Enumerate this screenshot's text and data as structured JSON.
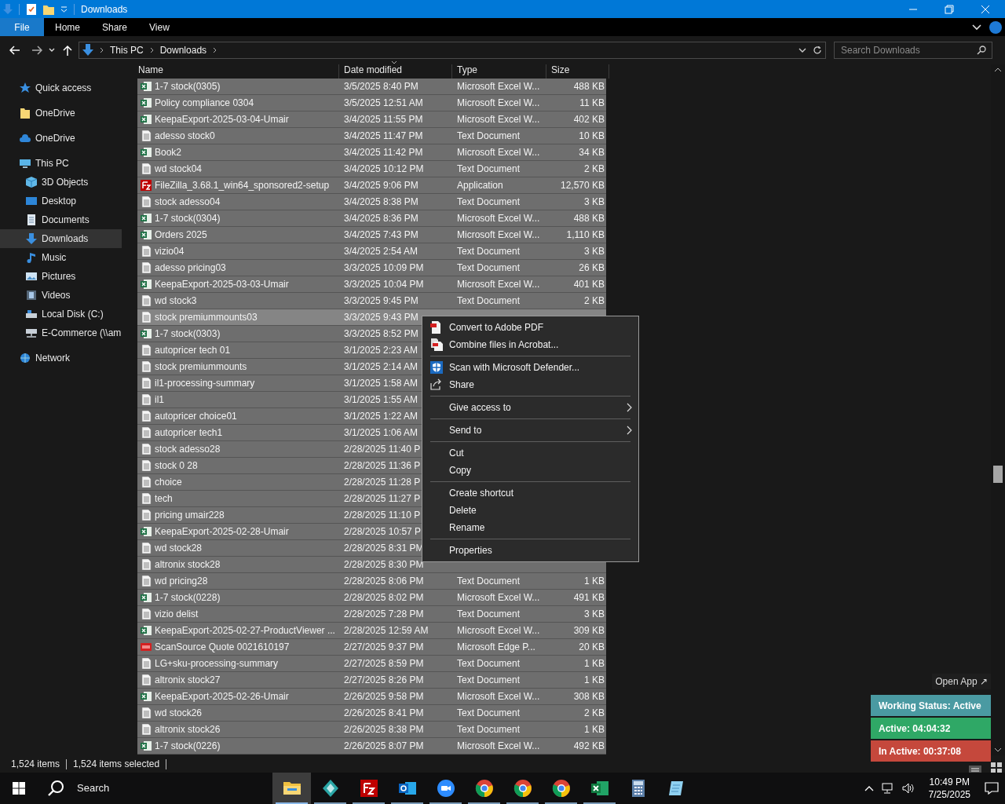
{
  "window": {
    "title": "Downloads"
  },
  "ribbon_tabs": [
    {
      "label": "File",
      "kind": "file",
      "selected": false
    },
    {
      "label": "Home",
      "kind": "tab",
      "selected": false
    },
    {
      "label": "Share",
      "kind": "tab",
      "selected": false
    },
    {
      "label": "View",
      "kind": "tab",
      "selected": false
    }
  ],
  "address": {
    "path": [
      "This PC",
      "Downloads"
    ],
    "search_placeholder": "Search Downloads"
  },
  "nav": [
    {
      "label": "Quick access",
      "selected": false
    },
    {
      "label": "OneDrive",
      "selected": false
    },
    {
      "label": "OneDrive",
      "selected": false
    },
    {
      "label": "This PC",
      "selected": false,
      "children": [
        {
          "label": "3D Objects",
          "selected": false
        },
        {
          "label": "Desktop",
          "selected": false
        },
        {
          "label": "Documents",
          "selected": false
        },
        {
          "label": "Downloads",
          "selected": true
        },
        {
          "label": "Music",
          "selected": false
        },
        {
          "label": "Pictures",
          "selected": false
        },
        {
          "label": "Videos",
          "selected": false
        },
        {
          "label": "Local Disk (C:)",
          "selected": false
        },
        {
          "label": "E-Commerce (\\\\am",
          "selected": false
        }
      ]
    },
    {
      "label": "Network",
      "selected": false
    }
  ],
  "columns": [
    "Name",
    "Date modified",
    "Type",
    "Size"
  ],
  "rows": [
    {
      "name": "1-7 stock(0305)",
      "date": "3/5/2025 8:40 PM",
      "type": "Microsoft Excel W...",
      "size": "488 KB",
      "kind": "excel",
      "selected": true,
      "focused": false
    },
    {
      "name": "Policy compliance 0304",
      "date": "3/5/2025 12:51 AM",
      "type": "Microsoft Excel W...",
      "size": "11 KB",
      "kind": "excel",
      "selected": true,
      "focused": false
    },
    {
      "name": "KeepaExport-2025-03-04-Umair",
      "date": "3/4/2025 11:55 PM",
      "type": "Microsoft Excel W...",
      "size": "402 KB",
      "kind": "excel",
      "selected": true,
      "focused": false
    },
    {
      "name": "adesso stock0",
      "date": "3/4/2025 11:47 PM",
      "type": "Text Document",
      "size": "10 KB",
      "kind": "text",
      "selected": true,
      "focused": false
    },
    {
      "name": "Book2",
      "date": "3/4/2025 11:42 PM",
      "type": "Microsoft Excel W...",
      "size": "34 KB",
      "kind": "excel",
      "selected": true,
      "focused": false
    },
    {
      "name": "wd stock04",
      "date": "3/4/2025 10:12 PM",
      "type": "Text Document",
      "size": "2 KB",
      "kind": "text",
      "selected": true,
      "focused": false
    },
    {
      "name": "FileZilla_3.68.1_win64_sponsored2-setup",
      "date": "3/4/2025 9:06 PM",
      "type": "Application",
      "size": "12,570 KB",
      "kind": "app",
      "selected": true,
      "focused": false
    },
    {
      "name": "stock adesso04",
      "date": "3/4/2025 8:38 PM",
      "type": "Text Document",
      "size": "3 KB",
      "kind": "text",
      "selected": true,
      "focused": false
    },
    {
      "name": "1-7 stock(0304)",
      "date": "3/4/2025 8:36 PM",
      "type": "Microsoft Excel W...",
      "size": "488 KB",
      "kind": "excel",
      "selected": true,
      "focused": false
    },
    {
      "name": "Orders 2025",
      "date": "3/4/2025 7:43 PM",
      "type": "Microsoft Excel W...",
      "size": "1,110 KB",
      "kind": "excel",
      "selected": true,
      "focused": false
    },
    {
      "name": "vizio04",
      "date": "3/4/2025 2:54 AM",
      "type": "Text Document",
      "size": "3 KB",
      "kind": "text",
      "selected": true,
      "focused": false
    },
    {
      "name": "adesso pricing03",
      "date": "3/3/2025 10:09 PM",
      "type": "Text Document",
      "size": "26 KB",
      "kind": "text",
      "selected": true,
      "focused": false
    },
    {
      "name": "KeepaExport-2025-03-03-Umair",
      "date": "3/3/2025 10:04 PM",
      "type": "Microsoft Excel W...",
      "size": "401 KB",
      "kind": "excel",
      "selected": true,
      "focused": false
    },
    {
      "name": "wd stock3",
      "date": "3/3/2025 9:45 PM",
      "type": "Text Document",
      "size": "2 KB",
      "kind": "text",
      "selected": true,
      "focused": false
    },
    {
      "name": "stock premiummounts03",
      "date": "3/3/2025 9:43 PM",
      "kind": "text",
      "selected": true,
      "focused": true
    },
    {
      "name": "1-7 stock(0303)",
      "date": "3/3/2025 8:52 PM",
      "kind": "excel",
      "selected": true,
      "focused": false
    },
    {
      "name": "autopricer tech 01",
      "date": "3/1/2025 2:23 AM",
      "kind": "text",
      "selected": true,
      "focused": false
    },
    {
      "name": "stock premiummounts",
      "date": "3/1/2025 2:14 AM",
      "kind": "text",
      "selected": true,
      "focused": false
    },
    {
      "name": "il1-processing-summary",
      "date": "3/1/2025 1:58 AM",
      "kind": "text",
      "selected": true,
      "focused": false
    },
    {
      "name": "il1",
      "date": "3/1/2025 1:55 AM",
      "kind": "text",
      "selected": true,
      "focused": false
    },
    {
      "name": "autopricer choice01",
      "date": "3/1/2025 1:22 AM",
      "kind": "text",
      "selected": true,
      "focused": false
    },
    {
      "name": "autopricer tech1",
      "date": "3/1/2025 1:06 AM",
      "kind": "text",
      "selected": true,
      "focused": false
    },
    {
      "name": "stock adesso28",
      "date": "2/28/2025 11:40 P",
      "kind": "text",
      "selected": true,
      "focused": false
    },
    {
      "name": "stock 0 28",
      "date": "2/28/2025 11:36 P",
      "kind": "text",
      "selected": true,
      "focused": false
    },
    {
      "name": "choice",
      "date": "2/28/2025 11:28 P",
      "kind": "text",
      "selected": true,
      "focused": false
    },
    {
      "name": "tech",
      "date": "2/28/2025 11:27 P",
      "kind": "text",
      "selected": true,
      "focused": false
    },
    {
      "name": "pricing umair228",
      "date": "2/28/2025 11:10 P",
      "kind": "text",
      "selected": true,
      "focused": false
    },
    {
      "name": "KeepaExport-2025-02-28-Umair",
      "date": "2/28/2025 10:57 P",
      "kind": "excel",
      "selected": true,
      "focused": false
    },
    {
      "name": "wd stock28",
      "date": "2/28/2025 8:31 PM",
      "kind": "text",
      "selected": true,
      "focused": false
    },
    {
      "name": "altronix stock28",
      "date": "2/28/2025 8:30 PM",
      "kind": "text",
      "selected": true,
      "focused": false
    },
    {
      "name": "wd pricing28",
      "date": "2/28/2025 8:06 PM",
      "type": "Text Document",
      "size": "1 KB",
      "kind": "text",
      "selected": true,
      "focused": false
    },
    {
      "name": "1-7 stock(0228)",
      "date": "2/28/2025 8:02 PM",
      "type": "Microsoft Excel W...",
      "size": "491 KB",
      "kind": "excel",
      "selected": true,
      "focused": false
    },
    {
      "name": "vizio delist",
      "date": "2/28/2025 7:28 PM",
      "type": "Text Document",
      "size": "3 KB",
      "kind": "text",
      "selected": true,
      "focused": false
    },
    {
      "name": "KeepaExport-2025-02-27-ProductViewer ...",
      "date": "2/28/2025 12:59 AM",
      "type": "Microsoft Excel W...",
      "size": "309 KB",
      "kind": "excel",
      "selected": true,
      "focused": false
    },
    {
      "name": "ScanSource Quote 0021610197",
      "date": "2/27/2025 9:37 PM",
      "type": "Microsoft Edge P...",
      "size": "20 KB",
      "kind": "pdf",
      "selected": true,
      "focused": false
    },
    {
      "name": "LG+sku-processing-summary",
      "date": "2/27/2025 8:59 PM",
      "type": "Text Document",
      "size": "1 KB",
      "kind": "text",
      "selected": true,
      "focused": false
    },
    {
      "name": "altronix stock27",
      "date": "2/27/2025 8:26 PM",
      "type": "Text Document",
      "size": "1 KB",
      "kind": "text",
      "selected": true,
      "focused": false
    },
    {
      "name": "KeepaExport-2025-02-26-Umair",
      "date": "2/26/2025 9:58 PM",
      "type": "Microsoft Excel W...",
      "size": "308 KB",
      "kind": "excel",
      "selected": true,
      "focused": false
    },
    {
      "name": "wd stock26",
      "date": "2/26/2025 8:41 PM",
      "type": "Text Document",
      "size": "2 KB",
      "kind": "text",
      "selected": true,
      "focused": false
    },
    {
      "name": "altronix stock26",
      "date": "2/26/2025 8:38 PM",
      "type": "Text Document",
      "size": "1 KB",
      "kind": "text",
      "selected": true,
      "focused": false
    },
    {
      "name": "1-7 stock(0226)",
      "date": "2/26/2025 8:07 PM",
      "type": "Microsoft Excel W...",
      "size": "492 KB",
      "kind": "excel",
      "selected": true,
      "focused": false
    }
  ],
  "context_menu": [
    [
      {
        "label": "Convert to Adobe PDF",
        "submenu": false
      },
      {
        "label": "Combine files in Acrobat...",
        "submenu": false
      }
    ],
    [
      {
        "label": "Scan with Microsoft Defender...",
        "submenu": false
      },
      {
        "label": "Share",
        "submenu": false
      }
    ],
    [
      {
        "label": "Give access to",
        "submenu": true
      }
    ],
    [
      {
        "label": "Send to",
        "submenu": true
      }
    ],
    [
      {
        "label": "Cut",
        "submenu": false
      },
      {
        "label": "Copy",
        "submenu": false
      }
    ],
    [
      {
        "label": "Create shortcut",
        "submenu": false
      },
      {
        "label": "Delete",
        "submenu": false
      },
      {
        "label": "Rename",
        "submenu": false
      }
    ],
    [
      {
        "label": "Properties",
        "submenu": false
      }
    ]
  ],
  "status_bar": [
    "1,524 items",
    "1,524 items selected"
  ],
  "widget": {
    "open_app": "Open App ↗",
    "statuses": [
      {
        "label": "Working Status: Active",
        "color": "#4a9aa2"
      },
      {
        "label": "Active: 04:04:32",
        "color": "#2fa866"
      },
      {
        "label": "In Active: 00:37:08",
        "color": "#c5483c"
      }
    ]
  },
  "taskbar": {
    "search": "Search",
    "apps": [
      {
        "active": true,
        "open": true
      },
      {
        "active": false,
        "open": true
      },
      {
        "active": false,
        "open": true
      },
      {
        "active": false,
        "open": true
      },
      {
        "active": false,
        "open": true
      },
      {
        "active": false,
        "open": true
      },
      {
        "active": false,
        "open": true
      },
      {
        "active": false,
        "open": true
      },
      {
        "active": false,
        "open": true
      },
      {
        "active": false,
        "open": false
      },
      {
        "active": false,
        "open": false
      }
    ],
    "time": "10:49 PM",
    "date": "7/25/2025"
  }
}
